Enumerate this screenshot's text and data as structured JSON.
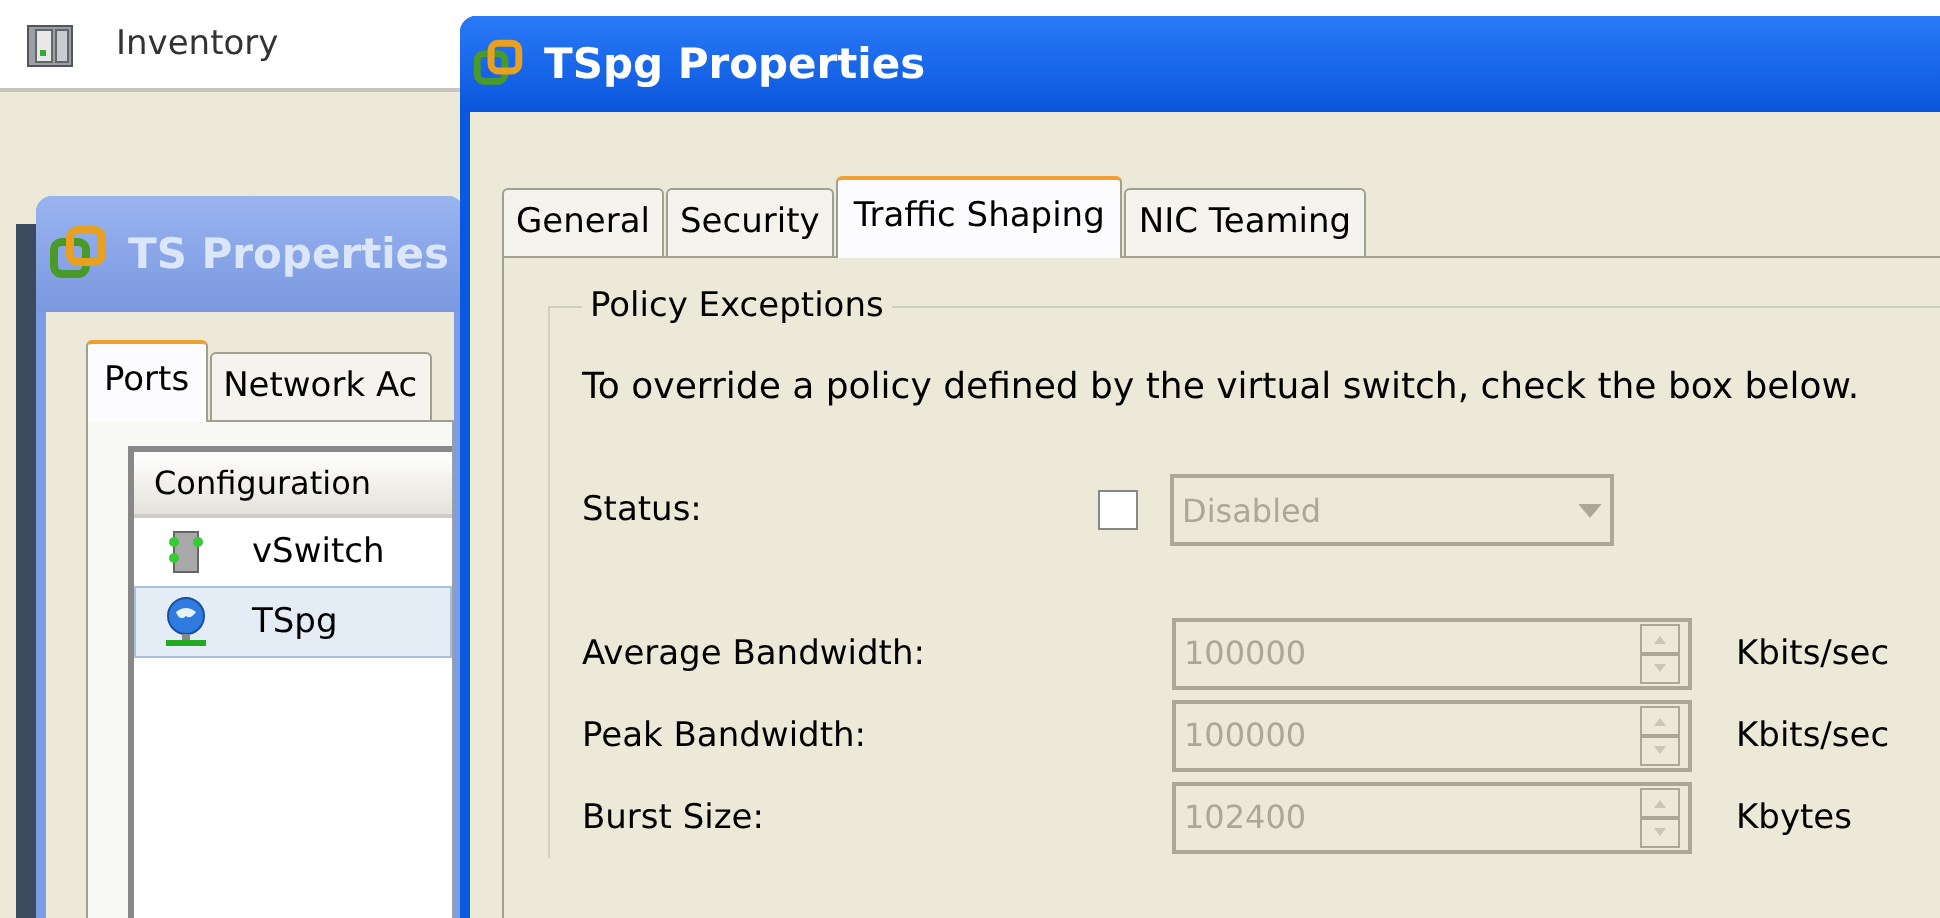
{
  "app_bar": {
    "title": "Inventory"
  },
  "back_window": {
    "title": "TS Properties",
    "tabs": [
      {
        "label": "Ports",
        "selected": true
      },
      {
        "label": "Network Ac",
        "selected": false
      }
    ],
    "list": {
      "column": "Configuration",
      "rows": [
        {
          "name": "vSwitch",
          "kind": "switch",
          "selected": false
        },
        {
          "name": "TSpg",
          "kind": "portgroup",
          "selected": true
        }
      ]
    }
  },
  "front_window": {
    "title": "TSpg Properties",
    "tabs": [
      {
        "label": "General",
        "selected": false
      },
      {
        "label": "Security",
        "selected": false
      },
      {
        "label": "Traffic Shaping",
        "selected": true
      },
      {
        "label": "NIC Teaming",
        "selected": false
      }
    ],
    "group": {
      "title": "Policy Exceptions",
      "description": "To override a policy defined by the virtual switch, check the box below.",
      "status": {
        "label": "Status:",
        "checked": false,
        "value": "Disabled",
        "disabled": true
      },
      "fields": [
        {
          "label": "Average Bandwidth:",
          "value": "100000",
          "unit": "Kbits/sec",
          "disabled": true
        },
        {
          "label": "Peak Bandwidth:",
          "value": "100000",
          "unit": "Kbits/sec",
          "disabled": true
        },
        {
          "label": "Burst Size:",
          "value": "102400",
          "unit": "Kbytes",
          "disabled": true
        }
      ]
    }
  }
}
